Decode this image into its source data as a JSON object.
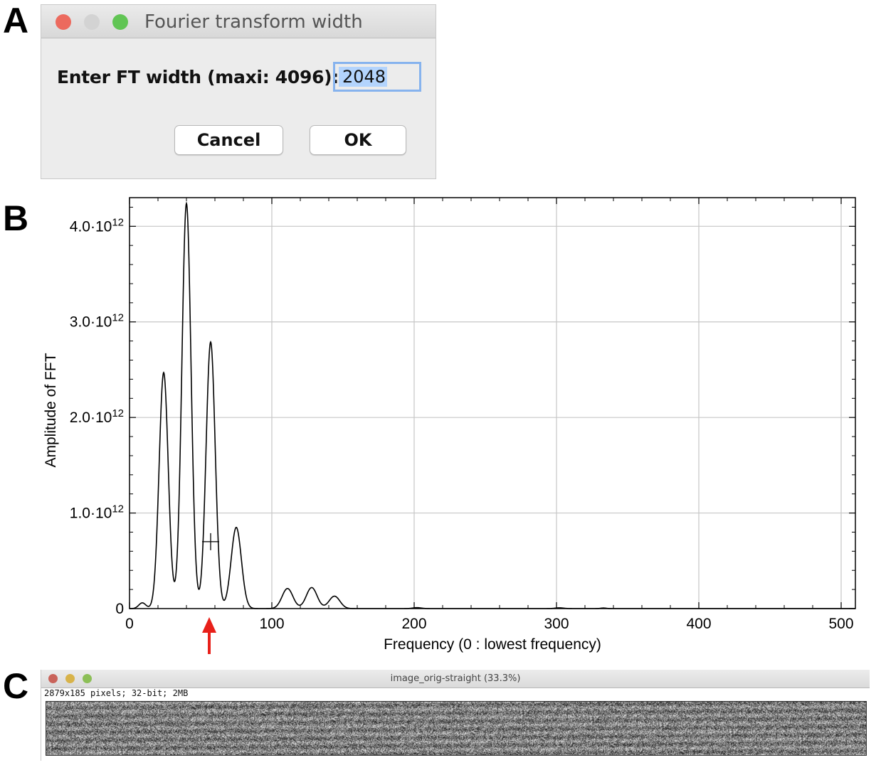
{
  "panel_labels": {
    "a": "A",
    "b": "B",
    "c": "C"
  },
  "dialog": {
    "title": "Fourier transform width",
    "prompt": "Enter FT width (maxi: 4096):",
    "field_value": "2048",
    "cancel_label": "Cancel",
    "ok_label": "OK",
    "traffic_colors": [
      "#ec6a5e",
      "#d3d3d3",
      "#61c554"
    ]
  },
  "chart_data": {
    "type": "line",
    "xlabel": "Frequency (0 : lowest frequency)",
    "ylabel": "Amplitude of FFT",
    "xlim": [
      0,
      510
    ],
    "ylim": [
      0,
      4300000000000.0
    ],
    "x_ticks": [
      "0",
      "100",
      "200",
      "300",
      "400",
      "500"
    ],
    "y_ticks": [
      {
        "mantissa": "0",
        "exp": ""
      },
      {
        "mantissa": "1.0·10",
        "exp": "12"
      },
      {
        "mantissa": "2.0·10",
        "exp": "12"
      },
      {
        "mantissa": "3.0·10",
        "exp": "12"
      },
      {
        "mantissa": "4.0·10",
        "exp": "12"
      }
    ],
    "grid": true,
    "peaks": [
      {
        "x": 9,
        "y": 60000000000.0,
        "w": 2.5
      },
      {
        "x": 24,
        "y": 2470000000000.0,
        "w": 3.2
      },
      {
        "x": 40,
        "y": 4240000000000.0,
        "w": 3.2
      },
      {
        "x": 57,
        "y": 2790000000000.0,
        "w": 3.2
      },
      {
        "x": 75,
        "y": 850000000000.0,
        "w": 3.6
      },
      {
        "x": 111,
        "y": 210000000000.0,
        "w": 3.8
      },
      {
        "x": 128,
        "y": 220000000000.0,
        "w": 3.8
      },
      {
        "x": 144,
        "y": 130000000000.0,
        "w": 3.8
      },
      {
        "x": 202,
        "y": 10000000000.0,
        "w": 3.0
      },
      {
        "x": 302,
        "y": 8000000000.0,
        "w": 3.0
      },
      {
        "x": 333,
        "y": 6000000000.0,
        "w": 2.0
      }
    ],
    "cursor_marker": {
      "x": 57,
      "y": 700000000000.0
    },
    "arrow_at_x": 56,
    "arrow_color": "#e8201a"
  },
  "image_window": {
    "title": "image_orig-straight (33.3%)",
    "info": "2879x185 pixels; 32-bit; 2MB",
    "traffic_colors": [
      "#c9635a",
      "#d8b34a",
      "#8cbf57"
    ]
  }
}
